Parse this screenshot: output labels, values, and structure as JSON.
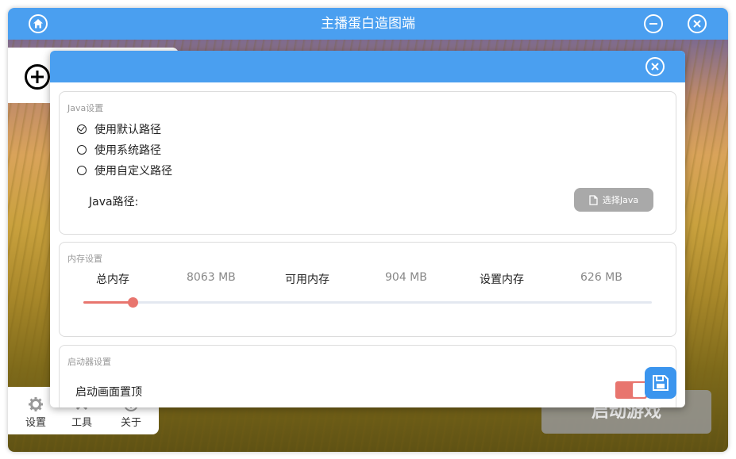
{
  "window": {
    "title": "主播蛋白造图端"
  },
  "nav": {
    "items": [
      {
        "label": "设置",
        "icon": "gear-icon"
      },
      {
        "label": "工具",
        "icon": "tools-icon"
      },
      {
        "label": "关于",
        "icon": "info-icon"
      }
    ]
  },
  "start_button": {
    "label": "启动游戏"
  },
  "java": {
    "section_title": "Java设置",
    "options": [
      {
        "label": "使用默认路径",
        "checked": true
      },
      {
        "label": "使用系统路径",
        "checked": false
      },
      {
        "label": "使用自定义路径",
        "checked": false
      }
    ],
    "path_label": "Java路径:",
    "choose_label": "选择Java"
  },
  "memory": {
    "section_title": "内存设置",
    "total_label": "总内存",
    "total_value": "8063 MB",
    "available_label": "可用内存",
    "available_value": "904 MB",
    "set_label": "设置内存",
    "set_value": "626 MB",
    "slider_fraction": 0.086
  },
  "launcher": {
    "section_title": "启动器设置",
    "on_top_label": "启动画面置顶",
    "on_top_enabled": true
  },
  "colors": {
    "accent": "#4a9ff0",
    "slider": "#e8756e"
  }
}
